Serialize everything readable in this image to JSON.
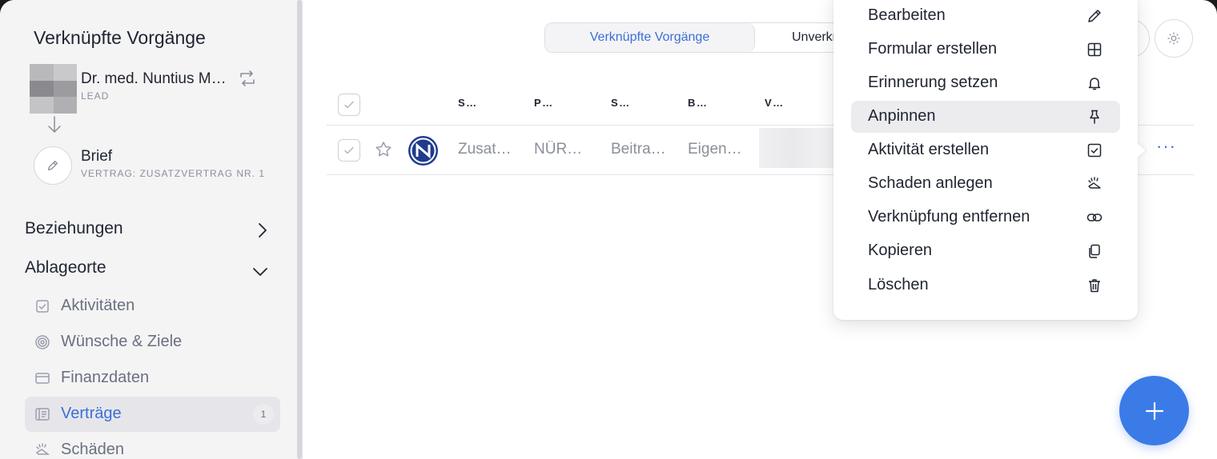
{
  "sidebar": {
    "title": "Verknüpfte Vorgänge",
    "person": {
      "name": "Dr. med. Nuntius Meyer",
      "role": "LEAD"
    },
    "brief": {
      "title": "Brief",
      "subtitle": "VERTRAG: ZUSATZVERTRAG NR. 1"
    },
    "sections": {
      "beziehungen": "Beziehungen",
      "ablageorte": "Ablageorte"
    },
    "items": [
      {
        "label": "Aktivitäten",
        "icon": "checkbox-icon"
      },
      {
        "label": "Wünsche & Ziele",
        "icon": "target-icon"
      },
      {
        "label": "Finanzdaten",
        "icon": "wallet-icon"
      },
      {
        "label": "Verträge",
        "icon": "contract-icon",
        "count": "1",
        "active": true
      },
      {
        "label": "Schäden",
        "icon": "damage-icon"
      }
    ]
  },
  "tabs": {
    "active": "Verknüpfte Vorgänge",
    "other": "Unverknüpfte Vorgänge"
  },
  "table": {
    "headers": [
      "SPARTE",
      "PRODUKT",
      "STATUS",
      "BEITRAG",
      "VERTRAGSNR"
    ],
    "row": {
      "sparte": "Zusatzvertrag",
      "produkt": "NÜRNBERGER",
      "status": "Beitragsfrei",
      "beitrag": "Eigenvertrag"
    }
  },
  "menu": {
    "items": [
      {
        "label": "Bearbeiten",
        "icon": "pencil-icon"
      },
      {
        "label": "Formular erstellen",
        "icon": "grid-icon"
      },
      {
        "label": "Erinnerung setzen",
        "icon": "bell-icon"
      },
      {
        "label": "Anpinnen",
        "icon": "pin-icon",
        "highlighted": true
      },
      {
        "label": "Aktivität erstellen",
        "icon": "checkbox-icon"
      },
      {
        "label": "Schaden anlegen",
        "icon": "damage-icon"
      },
      {
        "label": "Verknüpfung entfernen",
        "icon": "unlink-icon"
      },
      {
        "label": "Kopieren",
        "icon": "copy-icon"
      },
      {
        "label": "Löschen",
        "icon": "trash-icon"
      }
    ]
  },
  "colors": {
    "accent": "#3b6fd8",
    "fab": "#3b7be8"
  }
}
